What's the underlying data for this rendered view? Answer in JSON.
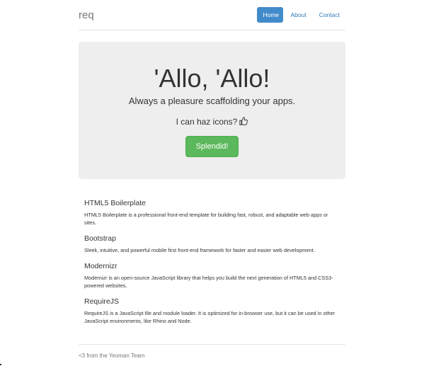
{
  "header": {
    "brand": "req",
    "nav": [
      {
        "label": "Home",
        "active": true
      },
      {
        "label": "About",
        "active": false
      },
      {
        "label": "Contact",
        "active": false
      }
    ]
  },
  "jumbotron": {
    "title": "'Allo, 'Allo!",
    "lead": "Always a pleasure scaffolding your apps.",
    "icons_text": "I can haz icons?",
    "icon": "thumbs-up-icon",
    "button_label": "Splendid!"
  },
  "marketing": [
    {
      "title": "HTML5 Boilerplate",
      "text": "HTML5 Boilerplate is a professional front-end template for building fast, robust, and adaptable web apps or sites."
    },
    {
      "title": "Bootstrap",
      "text": "Sleek, intuitive, and powerful mobile first front-end framework for faster and easier web development."
    },
    {
      "title": "Modernizr",
      "text": "Modernizr is an open-source JavaScript library that helps you build the next generation of HTML5 and CSS3-powered websites."
    },
    {
      "title": "RequireJS",
      "text": "RequireJS is a JavaScript file and module loader. It is optimized for in-browser use, but it can be used in other JavaScript environments, like Rhino and Node."
    }
  ],
  "footer": {
    "text": "<3 from the Yeoman Team"
  },
  "colors": {
    "primary": "#428bca",
    "success": "#5cb85c",
    "jumbotron_bg": "#eeeeee",
    "link": "#337ab7"
  }
}
